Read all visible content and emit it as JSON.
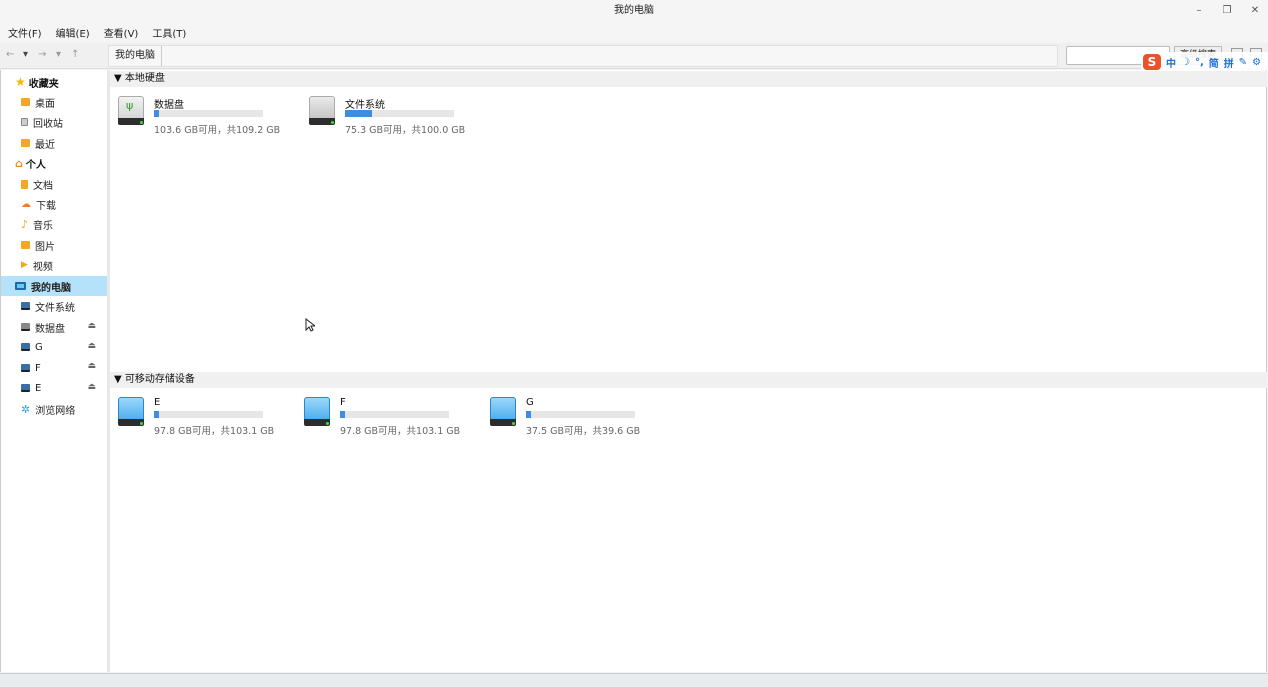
{
  "window": {
    "title": "我的电脑"
  },
  "menu": [
    "文件(F)",
    "编辑(E)",
    "查看(V)",
    "工具(T)"
  ],
  "toolbar": {
    "breadcrumb": "我的电脑",
    "search_value": "",
    "advanced_search_label": "高级搜索"
  },
  "ime": {
    "logo": "S",
    "items": [
      "中",
      "☽",
      "°,",
      "简",
      "拼",
      "✎",
      "⚙"
    ]
  },
  "sidebar": {
    "favorites": {
      "label": "收藏夹",
      "items": [
        "桌面",
        "回收站",
        "最近"
      ]
    },
    "personal": {
      "label": "个人",
      "items": [
        "文档",
        "下载",
        "音乐",
        "图片",
        "视频"
      ]
    },
    "computer": {
      "label": "我的电脑",
      "items": [
        "文件系统",
        "数据盘",
        "G",
        "F",
        "E"
      ]
    },
    "network": "浏览网络"
  },
  "sections": {
    "local": "▼ 本地硬盘",
    "removable": "▼ 可移动存储设备"
  },
  "local_drives": [
    {
      "name": "数据盘",
      "usage": "103.6 GB可用，共109.2 GB",
      "used_fraction": 0.05,
      "icon": "usb-drive-icon"
    },
    {
      "name": "文件系统",
      "usage": "75.3 GB可用，共100.0 GB",
      "used_fraction": 0.25,
      "icon": "system-drive-icon"
    }
  ],
  "removable_drives": [
    {
      "name": "E",
      "usage": "97.8 GB可用，共103.1 GB",
      "used_fraction": 0.05,
      "icon": "removable-drive-icon"
    },
    {
      "name": "F",
      "usage": "97.8 GB可用，共103.1 GB",
      "used_fraction": 0.05,
      "icon": "removable-drive-icon"
    },
    {
      "name": "G",
      "usage": "37.5 GB可用，共39.6 GB",
      "used_fraction": 0.05,
      "icon": "removable-drive-icon"
    }
  ]
}
